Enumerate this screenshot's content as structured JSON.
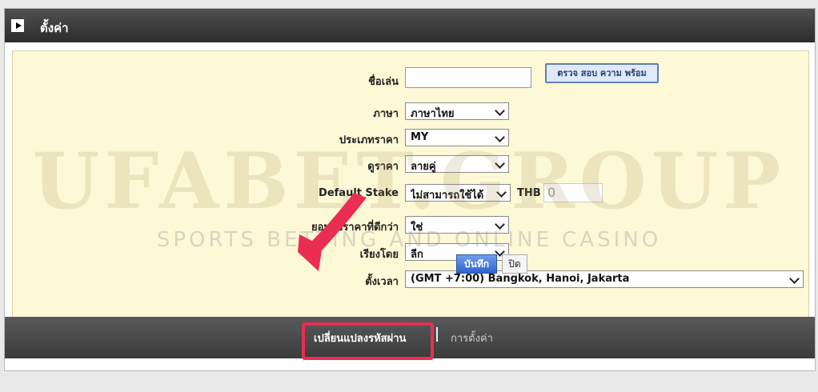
{
  "window": {
    "title": "ตั้งค่า"
  },
  "form": {
    "nickname_label": "ชื่อเล่น",
    "nickname_value": "",
    "check_button": "ตรวจ สอบ ความ พร้อม",
    "language_label": "ภาษา",
    "language_value": "ภาษาไทย",
    "odds_type_label": "ประเภทราคา",
    "odds_type_value": "MY",
    "odds_view_label": "ดูราคา",
    "odds_view_value": "ลายคู่",
    "default_stake_label": "Default Stake",
    "default_stake_value": "ไม่สามารถใช้ได้",
    "currency": "THB",
    "stake_amount": "0",
    "accept_better_odds_label": "ยอมรับราคาที่ดีกว่า",
    "accept_better_odds_value": "ใช่",
    "sort_by_label": "เรียงโดย",
    "sort_by_value": "ลีก",
    "timezone_label": "ตั้งเวลา",
    "timezone_value": "(GMT +7:00) Bangkok, Hanoi, Jakarta",
    "save_button": "บันทึก",
    "close_button": "ปิด"
  },
  "footer": {
    "change_password": "เปลี่ยนแปลงรหัสผ่าน",
    "separator": "|",
    "settings": "การตั้งค่า"
  },
  "watermark": {
    "brand": "UFABET.GROUP",
    "tagline": "SPORTS BETTING AND ONLINE CASINO"
  },
  "colors": {
    "highlight": "#ea2d52",
    "panel_bg": "#fdf8d6",
    "save_blue": "#2f63c9"
  }
}
